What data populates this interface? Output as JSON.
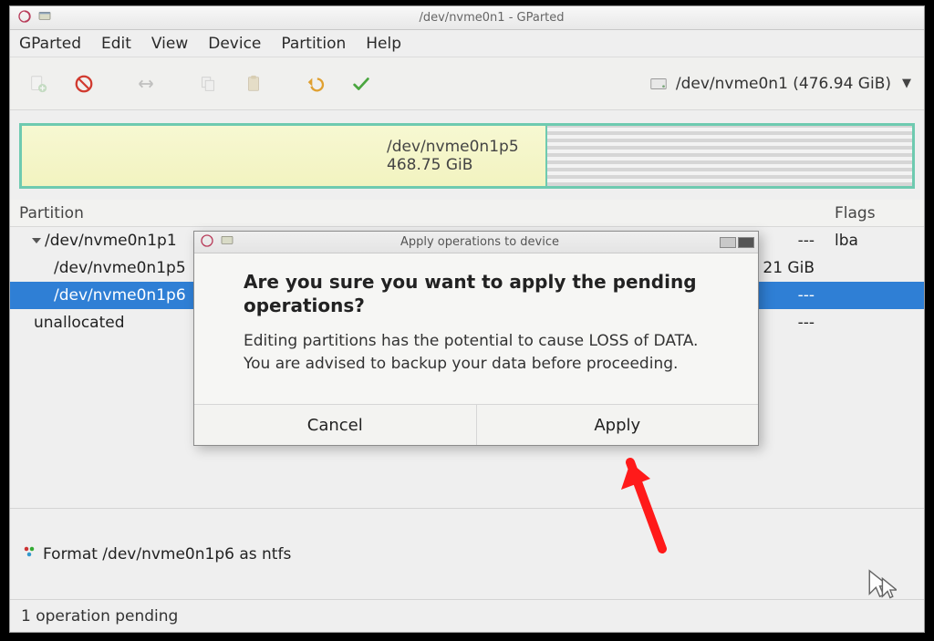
{
  "window": {
    "title": "/dev/nvme0n1 - GParted"
  },
  "menubar": {
    "items": [
      "GParted",
      "Edit",
      "View",
      "Device",
      "Partition",
      "Help"
    ]
  },
  "toolbar": {
    "new_icon": "new-partition-icon",
    "delete_icon": "delete-icon",
    "resize_icon": "resize-icon",
    "copy_icon": "copy-icon",
    "paste_icon": "paste-icon",
    "undo_icon": "undo-icon",
    "apply_icon": "apply-icon"
  },
  "device_picker": {
    "label": "/dev/nvme0n1 (476.94 GiB)"
  },
  "partmap": {
    "segment_name": "/dev/nvme0n1p5",
    "segment_size": "468.75 GiB"
  },
  "table": {
    "headers": {
      "partition": "Partition",
      "flags": "Flags"
    },
    "rows": [
      {
        "name": "/dev/nvme0n1p1",
        "used": "---",
        "flags": "lba",
        "indent": 1,
        "expander": true
      },
      {
        "name": "/dev/nvme0n1p5",
        "used": "21 GiB",
        "flags": "",
        "indent": 2
      },
      {
        "name": "/dev/nvme0n1p6",
        "used": "---",
        "flags": "",
        "indent": 2,
        "selected": true
      },
      {
        "name": "unallocated",
        "used": "---",
        "flags": "",
        "indent": 1
      }
    ]
  },
  "pending": {
    "op_text": "Format /dev/nvme0n1p6 as ntfs"
  },
  "statusbar": {
    "text": "1 operation pending"
  },
  "dialog": {
    "title": "Apply operations to device",
    "heading": "Are you sure you want to apply the pending operations?",
    "body": "Editing partitions has the potential to cause LOSS of DATA.\nYou are advised to backup your data before proceeding.",
    "cancel": "Cancel",
    "apply": "Apply"
  }
}
